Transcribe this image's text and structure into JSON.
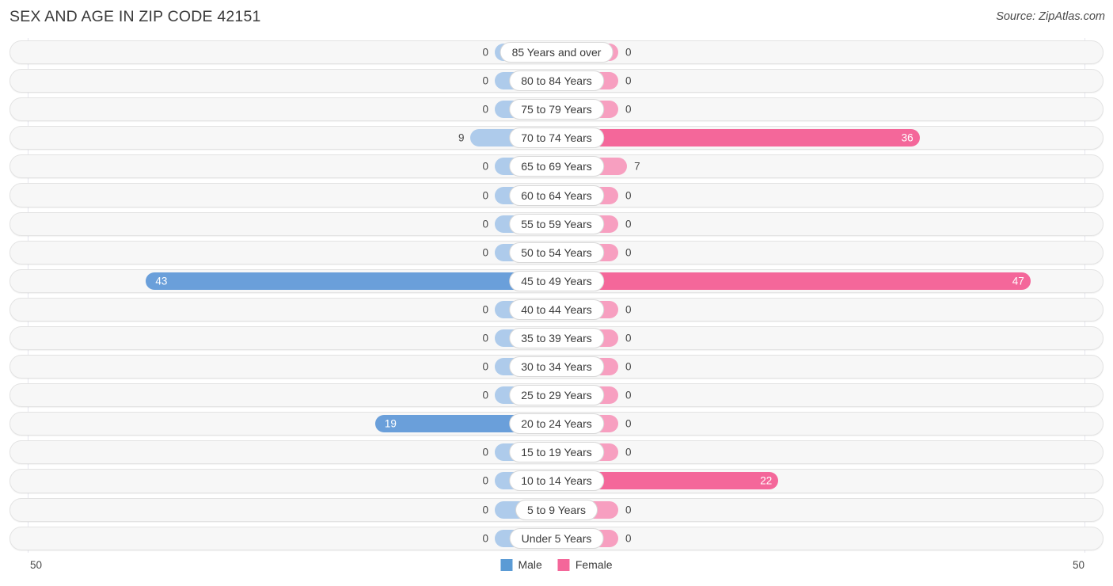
{
  "header": {
    "title": "SEX AND AGE IN ZIP CODE 42151",
    "source": "Source: ZipAtlas.com"
  },
  "footer": {
    "axis_left": "50",
    "axis_right": "50",
    "legend": [
      {
        "label": "Male",
        "color": "#5b9bd5"
      },
      {
        "label": "Female",
        "color": "#f4679a"
      }
    ]
  },
  "colors": {
    "male_light": "#aecbeb",
    "male_dark": "#6a9fda",
    "female_light": "#f79fc0",
    "female_dark": "#f4679a",
    "track_fill": "#f7f7f7",
    "track_border": "#e3e3e3",
    "gridline": "#e6e6ee"
  },
  "chart_data": {
    "type": "bar",
    "subtype": "diverging-population-pyramid",
    "title": "SEX AND AGE IN ZIP CODE 42151",
    "xlabel": "",
    "ylabel": "",
    "axis_max": 50,
    "xlim": [
      -50,
      50
    ],
    "grid": true,
    "legend_position": "bottom-center",
    "categories": [
      "85 Years and over",
      "80 to 84 Years",
      "75 to 79 Years",
      "70 to 74 Years",
      "65 to 69 Years",
      "60 to 64 Years",
      "55 to 59 Years",
      "50 to 54 Years",
      "45 to 49 Years",
      "40 to 44 Years",
      "35 to 39 Years",
      "30 to 34 Years",
      "25 to 29 Years",
      "20 to 24 Years",
      "15 to 19 Years",
      "10 to 14 Years",
      "5 to 9 Years",
      "Under 5 Years"
    ],
    "series": [
      {
        "name": "Male",
        "color": "#5b9bd5",
        "values": [
          0,
          0,
          0,
          9,
          0,
          0,
          0,
          0,
          43,
          0,
          0,
          0,
          0,
          19,
          0,
          0,
          0,
          0
        ]
      },
      {
        "name": "Female",
        "color": "#f4679a",
        "values": [
          0,
          0,
          0,
          36,
          7,
          0,
          0,
          0,
          47,
          0,
          0,
          0,
          0,
          0,
          0,
          22,
          0,
          0
        ]
      }
    ]
  }
}
